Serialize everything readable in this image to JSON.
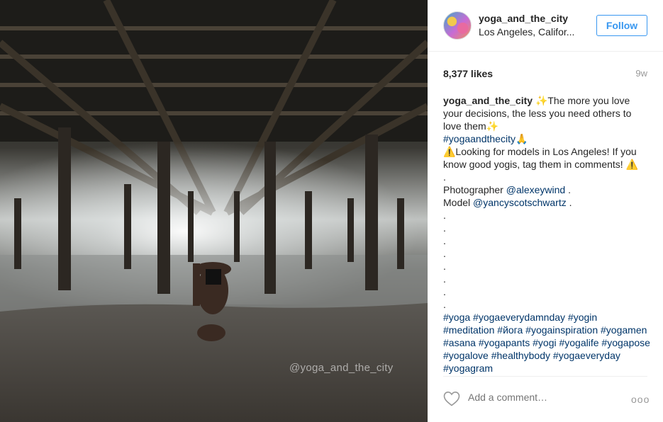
{
  "photo": {
    "watermark": "@yoga_and_the_city"
  },
  "post": {
    "username": "yoga_and_the_city",
    "location": "Los Angeles, Califor...",
    "follow_label": "Follow",
    "likes": "8,377 likes",
    "age": "9w"
  },
  "caption": {
    "author": "yoga_and_the_city",
    "text_1": " ✨The more you love your decisions, the less you need others to love them✨",
    "tag_1": "#yogaandthecity",
    "emoji_1": "🙏",
    "text_2": "⚠️Looking for models in Los Angeles! If you know good yogis, tag them in comments! ⚠️",
    "dot": ".",
    "photographer_label": "Photographer ",
    "photographer_handle": "@alexeywind",
    "photographer_suffix": " .",
    "model_label": "Model ",
    "model_handle": "@yancyscotschwartz",
    "model_suffix": " .",
    "hashtags": [
      "#yoga",
      "#yogaeverydamnday",
      "#yogin",
      "#meditation",
      "#йога",
      "#yogainspiration",
      "#yogamen",
      "#asana",
      "#yogapants",
      "#yogi",
      "#yogalife",
      "#yogapose",
      "#yogalove",
      "#healthybody",
      "#yogaeveryday",
      "#yogagram"
    ]
  },
  "footer": {
    "comment_placeholder": "Add a comment…",
    "more_label": "ooo"
  },
  "colors": {
    "link": "#003569",
    "accent": "#3897f0",
    "muted": "#999999"
  },
  "icons": {
    "like": "heart-outline-icon",
    "more": "more-options-icon"
  }
}
